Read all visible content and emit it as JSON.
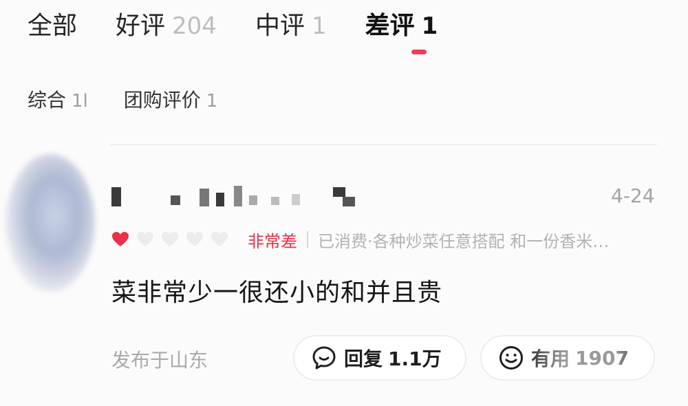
{
  "tabs": [
    {
      "label": "全部",
      "count": ""
    },
    {
      "label": "好评",
      "count": "204"
    },
    {
      "label": "中评",
      "count": "1"
    },
    {
      "label": "差评",
      "count": "1"
    }
  ],
  "active_tab": "差评",
  "filters": [
    {
      "label": "综合",
      "count": "1l"
    },
    {
      "label": "团购评价",
      "count": "1"
    }
  ],
  "review": {
    "date": "4-24",
    "rating_hearts_filled": 1,
    "rating_hearts_total": 5,
    "rating_text": "非常差",
    "consume_info": "已消费·各种炒菜任意搭配 和一份香米…",
    "content": "菜非常少一很还小的和并且贵",
    "location": "发布于山东",
    "reply_label": "回复",
    "reply_count": "1.1万",
    "useful_label": "有用",
    "useful_count": "1907"
  },
  "colors": {
    "accent": "#f23c5c",
    "rating_red": "#e8324a",
    "muted": "#a9a9a9"
  },
  "icons": {
    "reply": "comment-bubble-icon",
    "useful": "smiley-icon",
    "heart_filled": "heart-filled-icon",
    "heart_empty": "heart-empty-icon"
  }
}
